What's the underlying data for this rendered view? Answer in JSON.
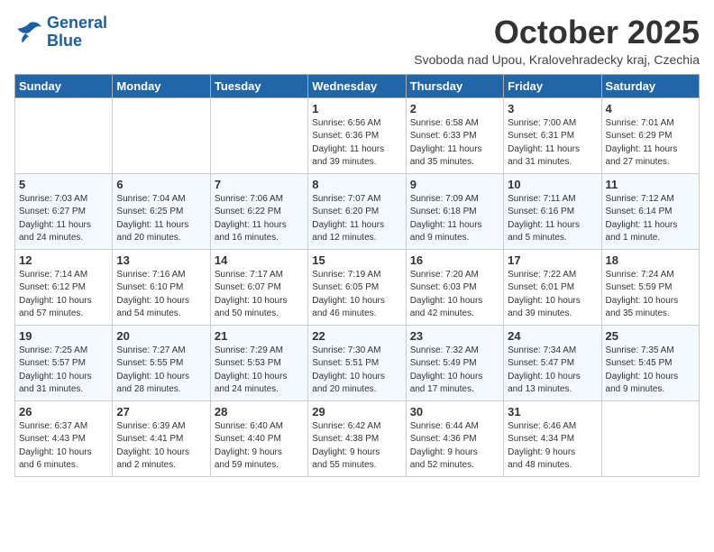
{
  "logo": {
    "line1": "General",
    "line2": "Blue"
  },
  "title": "October 2025",
  "subtitle": "Svoboda nad Upou, Kralovehradecky kraj, Czechia",
  "days_of_week": [
    "Sunday",
    "Monday",
    "Tuesday",
    "Wednesday",
    "Thursday",
    "Friday",
    "Saturday"
  ],
  "weeks": [
    [
      {
        "day": "",
        "info": ""
      },
      {
        "day": "",
        "info": ""
      },
      {
        "day": "",
        "info": ""
      },
      {
        "day": "1",
        "info": "Sunrise: 6:56 AM\nSunset: 6:36 PM\nDaylight: 11 hours\nand 39 minutes."
      },
      {
        "day": "2",
        "info": "Sunrise: 6:58 AM\nSunset: 6:33 PM\nDaylight: 11 hours\nand 35 minutes."
      },
      {
        "day": "3",
        "info": "Sunrise: 7:00 AM\nSunset: 6:31 PM\nDaylight: 11 hours\nand 31 minutes."
      },
      {
        "day": "4",
        "info": "Sunrise: 7:01 AM\nSunset: 6:29 PM\nDaylight: 11 hours\nand 27 minutes."
      }
    ],
    [
      {
        "day": "5",
        "info": "Sunrise: 7:03 AM\nSunset: 6:27 PM\nDaylight: 11 hours\nand 24 minutes."
      },
      {
        "day": "6",
        "info": "Sunrise: 7:04 AM\nSunset: 6:25 PM\nDaylight: 11 hours\nand 20 minutes."
      },
      {
        "day": "7",
        "info": "Sunrise: 7:06 AM\nSunset: 6:22 PM\nDaylight: 11 hours\nand 16 minutes."
      },
      {
        "day": "8",
        "info": "Sunrise: 7:07 AM\nSunset: 6:20 PM\nDaylight: 11 hours\nand 12 minutes."
      },
      {
        "day": "9",
        "info": "Sunrise: 7:09 AM\nSunset: 6:18 PM\nDaylight: 11 hours\nand 9 minutes."
      },
      {
        "day": "10",
        "info": "Sunrise: 7:11 AM\nSunset: 6:16 PM\nDaylight: 11 hours\nand 5 minutes."
      },
      {
        "day": "11",
        "info": "Sunrise: 7:12 AM\nSunset: 6:14 PM\nDaylight: 11 hours\nand 1 minute."
      }
    ],
    [
      {
        "day": "12",
        "info": "Sunrise: 7:14 AM\nSunset: 6:12 PM\nDaylight: 10 hours\nand 57 minutes."
      },
      {
        "day": "13",
        "info": "Sunrise: 7:16 AM\nSunset: 6:10 PM\nDaylight: 10 hours\nand 54 minutes."
      },
      {
        "day": "14",
        "info": "Sunrise: 7:17 AM\nSunset: 6:07 PM\nDaylight: 10 hours\nand 50 minutes."
      },
      {
        "day": "15",
        "info": "Sunrise: 7:19 AM\nSunset: 6:05 PM\nDaylight: 10 hours\nand 46 minutes."
      },
      {
        "day": "16",
        "info": "Sunrise: 7:20 AM\nSunset: 6:03 PM\nDaylight: 10 hours\nand 42 minutes."
      },
      {
        "day": "17",
        "info": "Sunrise: 7:22 AM\nSunset: 6:01 PM\nDaylight: 10 hours\nand 39 minutes."
      },
      {
        "day": "18",
        "info": "Sunrise: 7:24 AM\nSunset: 5:59 PM\nDaylight: 10 hours\nand 35 minutes."
      }
    ],
    [
      {
        "day": "19",
        "info": "Sunrise: 7:25 AM\nSunset: 5:57 PM\nDaylight: 10 hours\nand 31 minutes."
      },
      {
        "day": "20",
        "info": "Sunrise: 7:27 AM\nSunset: 5:55 PM\nDaylight: 10 hours\nand 28 minutes."
      },
      {
        "day": "21",
        "info": "Sunrise: 7:29 AM\nSunset: 5:53 PM\nDaylight: 10 hours\nand 24 minutes."
      },
      {
        "day": "22",
        "info": "Sunrise: 7:30 AM\nSunset: 5:51 PM\nDaylight: 10 hours\nand 20 minutes."
      },
      {
        "day": "23",
        "info": "Sunrise: 7:32 AM\nSunset: 5:49 PM\nDaylight: 10 hours\nand 17 minutes."
      },
      {
        "day": "24",
        "info": "Sunrise: 7:34 AM\nSunset: 5:47 PM\nDaylight: 10 hours\nand 13 minutes."
      },
      {
        "day": "25",
        "info": "Sunrise: 7:35 AM\nSunset: 5:45 PM\nDaylight: 10 hours\nand 9 minutes."
      }
    ],
    [
      {
        "day": "26",
        "info": "Sunrise: 6:37 AM\nSunset: 4:43 PM\nDaylight: 10 hours\nand 6 minutes."
      },
      {
        "day": "27",
        "info": "Sunrise: 6:39 AM\nSunset: 4:41 PM\nDaylight: 10 hours\nand 2 minutes."
      },
      {
        "day": "28",
        "info": "Sunrise: 6:40 AM\nSunset: 4:40 PM\nDaylight: 9 hours\nand 59 minutes."
      },
      {
        "day": "29",
        "info": "Sunrise: 6:42 AM\nSunset: 4:38 PM\nDaylight: 9 hours\nand 55 minutes."
      },
      {
        "day": "30",
        "info": "Sunrise: 6:44 AM\nSunset: 4:36 PM\nDaylight: 9 hours\nand 52 minutes."
      },
      {
        "day": "31",
        "info": "Sunrise: 6:46 AM\nSunset: 4:34 PM\nDaylight: 9 hours\nand 48 minutes."
      },
      {
        "day": "",
        "info": ""
      }
    ]
  ]
}
